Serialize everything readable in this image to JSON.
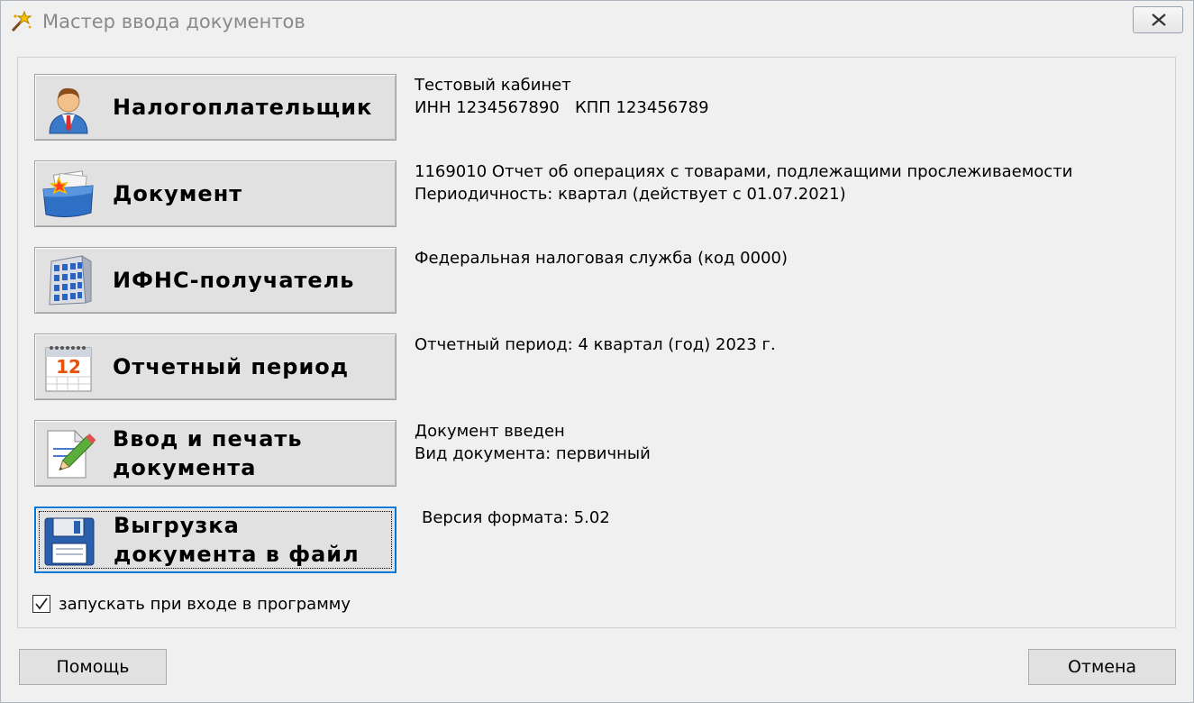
{
  "window": {
    "title": "Мастер ввода документов",
    "icon": "wizard-wand-icon",
    "close_icon": "close-icon"
  },
  "steps": [
    {
      "label": "Налогоплательщик",
      "icon": "taxpayer-person-icon",
      "info": [
        "Тестовый кабинет",
        "ИНН 1234567890   КПП 123456789"
      ]
    },
    {
      "label": "Документ",
      "icon": "document-folder-icon",
      "info": [
        "1169010 Отчет об операциях с товарами, подлежащими прослеживаемости",
        "Периодичность: квартал (действует с 01.07.2021)"
      ]
    },
    {
      "label": "ИФНС-получатель",
      "icon": "tax-office-building-icon",
      "info": [
        "Федеральная налоговая служба (код 0000)"
      ]
    },
    {
      "label": "Отчетный период",
      "icon": "calendar-icon",
      "calendar_number": "12",
      "info": [
        "Отчетный период: 4 квартал (год) 2023 г."
      ]
    },
    {
      "label_line1": "Ввод и печать",
      "label_line2": "документа",
      "icon": "edit-document-pencil-icon",
      "info": [
        "Документ введен",
        "Вид документа: первичный"
      ]
    },
    {
      "label_line1": "Выгрузка",
      "label_line2": "документа в файл",
      "icon": "floppy-disk-save-icon",
      "info": [
        "Версия формата: 5.02"
      ],
      "focused": true
    }
  ],
  "autostart": {
    "label": "запускать при входе в программу",
    "checked": true
  },
  "buttons": {
    "help": "Помощь",
    "cancel": "Отмена"
  },
  "colors": {
    "background": "#f0f0f0",
    "button_face": "#e1e1e1",
    "focus_border": "#0078d7",
    "title_text": "#8a8a8a"
  }
}
